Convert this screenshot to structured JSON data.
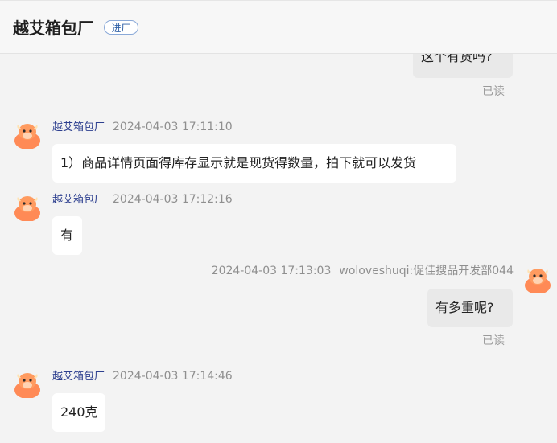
{
  "header": {
    "title": "越艾箱包厂",
    "badge": "进厂"
  },
  "messages": [
    {
      "id": "m1",
      "direction": "outgoing",
      "text": "这个有货吗?",
      "read_status": "已读"
    },
    {
      "id": "m2",
      "direction": "incoming",
      "sender": "越艾箱包厂",
      "time": "2024-04-03 17:11:10",
      "text": "1）商品详情页面得库存显示就是现货得数量，拍下就可以发货"
    },
    {
      "id": "m3",
      "direction": "incoming",
      "sender": "越艾箱包厂",
      "time": "2024-04-03 17:12:16",
      "text": "有"
    },
    {
      "id": "m4",
      "direction": "outgoing",
      "sender": "woloveshuqi:促佳搜品开发部044",
      "time": "2024-04-03 17:13:03",
      "text": "有多重呢?",
      "read_status": "已读"
    },
    {
      "id": "m5",
      "direction": "incoming",
      "sender": "越艾箱包厂",
      "time": "2024-04-03 17:14:46",
      "text": "240克"
    }
  ],
  "partial_footer_text": "……",
  "colors": {
    "accent": "#2d3f8f",
    "badge": "#2d5fa6",
    "outgoing_bubble": "#e9e9e9",
    "incoming_bubble": "#ffffff",
    "avatar": "#ff7a45"
  },
  "icons": {
    "avatar_icon": "cartoon-cow-avatar-icon"
  }
}
